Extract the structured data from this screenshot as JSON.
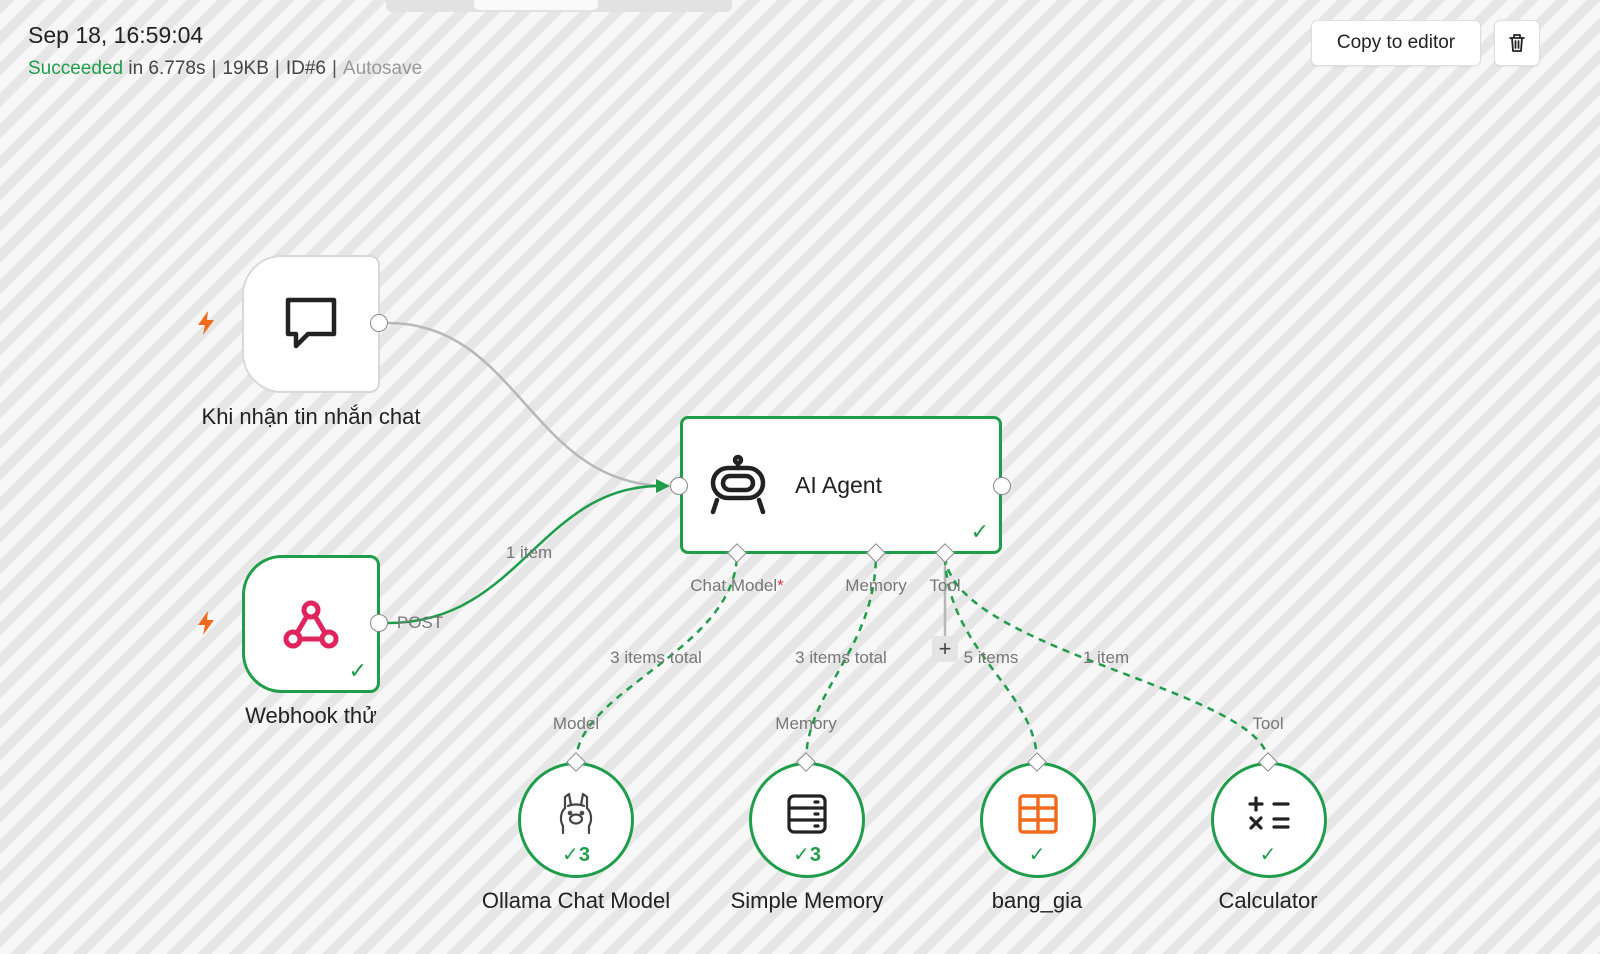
{
  "execution": {
    "date": "Sep 18, 16:59:04",
    "status": "Succeeded",
    "duration": "in 6.778s",
    "size": "19KB",
    "id": "ID#6",
    "autosave": "Autosave"
  },
  "actions": {
    "copy_to_editor": "Copy to editor"
  },
  "nodes": {
    "chat_trigger": {
      "label": "Khi nhận tin nhắn chat",
      "icon": "chat-bubble-icon"
    },
    "webhook": {
      "label": "Webhook thử",
      "icon": "webhook-icon",
      "output": "POST"
    },
    "agent": {
      "label": "AI Agent",
      "icon": "robot-icon"
    },
    "ollama": {
      "label": "Ollama Chat Model",
      "icon": "llama-icon",
      "count": "3",
      "port": "Model"
    },
    "memory": {
      "label": "Simple Memory",
      "icon": "database-icon",
      "count": "3",
      "port": "Memory"
    },
    "bang_gia": {
      "label": "bang_gia",
      "icon": "table-icon"
    },
    "calculator": {
      "label": "Calculator",
      "icon": "calculator-icon",
      "port": "Tool"
    }
  },
  "agent_ports": {
    "chat_model": "Chat Model",
    "required_mark": "*",
    "memory": "Memory",
    "tool": "Tool"
  },
  "connections": {
    "webhook_to_agent": "1 item",
    "model": "3 items total",
    "memory": "3 items total",
    "bang_gia": "5 items",
    "calculator": "1 item"
  },
  "colors": {
    "success": "#1f9d4a",
    "trigger_bolt": "#f26b1d",
    "webhook": "#e0245e",
    "table": "#f26b1d"
  }
}
